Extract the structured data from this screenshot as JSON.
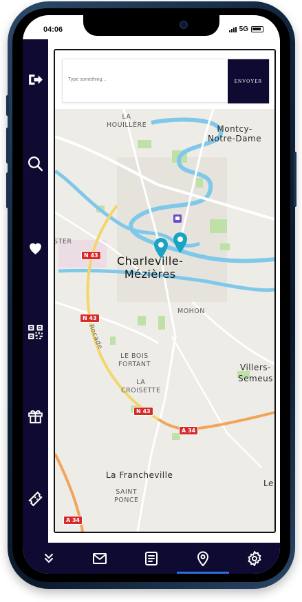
{
  "status_bar": {
    "time": "04:06",
    "network": "5G"
  },
  "sidebar": {
    "items": [
      {
        "name": "logout-icon"
      },
      {
        "name": "search-icon"
      },
      {
        "name": "heart-icon"
      },
      {
        "name": "qr-code-icon"
      },
      {
        "name": "gift-icon"
      },
      {
        "name": "ticket-icon"
      }
    ]
  },
  "search": {
    "placeholder": "Type something...",
    "value": "",
    "send_label": "ENVOYER"
  },
  "map": {
    "labels": {
      "la_houillere": "LA\nHOUILLÈRE",
      "montcy": "Montcy-\nNotre-Dame",
      "city": "Charleville-\nMézières",
      "ster": "STER",
      "mohon": "MOHON",
      "le_bois_fortant": "LE BOIS\nFORTANT",
      "la_croisette": "LA\nCROISETTE",
      "villers": "Villers-\nSemeus",
      "la_francheville": "La Francheville",
      "saint_ponce": "SAINT\nPONCE",
      "rocade": "Rocade",
      "le": "Le"
    },
    "road_badges": {
      "n43_a": "N 43",
      "n43_b": "N 43",
      "n43_c": "N 43",
      "a34_a": "A 34",
      "a34_b": "A 34"
    },
    "pin_color": "#1aa3c4",
    "river_color": "#7fc8ea"
  },
  "bottom_nav": {
    "items": [
      {
        "name": "expand-down-icon"
      },
      {
        "name": "mail-icon"
      },
      {
        "name": "document-icon"
      },
      {
        "name": "location-pin-icon",
        "active": true
      },
      {
        "name": "settings-icon"
      }
    ]
  },
  "colors": {
    "navy": "#0e0a31",
    "active_indicator": "#2f6fe0"
  }
}
